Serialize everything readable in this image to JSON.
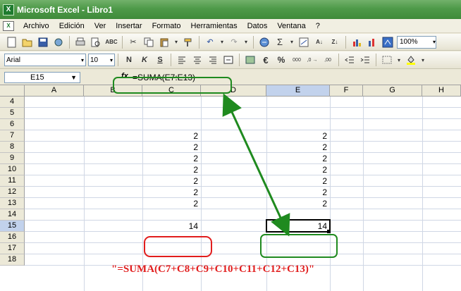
{
  "window": {
    "title": "Microsoft Excel - Libro1",
    "app_icon_glyph": "X"
  },
  "menu": [
    "Archivo",
    "Edición",
    "Ver",
    "Insertar",
    "Formato",
    "Herramientas",
    "Datos",
    "Ventana",
    "?"
  ],
  "toolbar": {
    "zoom": "100%"
  },
  "format_toolbar": {
    "font": "Arial",
    "size": "10",
    "bold": "N",
    "italic": "K",
    "underline": "S",
    "currency": "€",
    "percent": "%",
    "thousands": "000"
  },
  "formula_bar": {
    "name_box": "E15",
    "fx_label": "fx",
    "formula": "=SUMA(E7:E13)"
  },
  "grid": {
    "columns": [
      "A",
      "B",
      "C",
      "D",
      "E",
      "F",
      "G",
      "H"
    ],
    "rows": [
      "4",
      "5",
      "6",
      "7",
      "8",
      "9",
      "10",
      "11",
      "12",
      "13",
      "14",
      "15",
      "16",
      "17",
      "18"
    ],
    "cells": {
      "C7": "2",
      "C8": "2",
      "C9": "2",
      "C10": "2",
      "C11": "2",
      "C12": "2",
      "C13": "2",
      "C15": "14",
      "E7": "2",
      "E8": "2",
      "E9": "2",
      "E10": "2",
      "E11": "2",
      "E12": "2",
      "E13": "2",
      "E15": "14"
    },
    "selected_column": "E",
    "selected_row": "15"
  },
  "annotation": {
    "text": "\"=SUMA(C7+C8+C9+C10+C11+C12+C13)\""
  },
  "colors": {
    "title_bar": "#4e9a49",
    "highlight_green": "#1f8a1f",
    "highlight_red": "#e11d1d"
  }
}
